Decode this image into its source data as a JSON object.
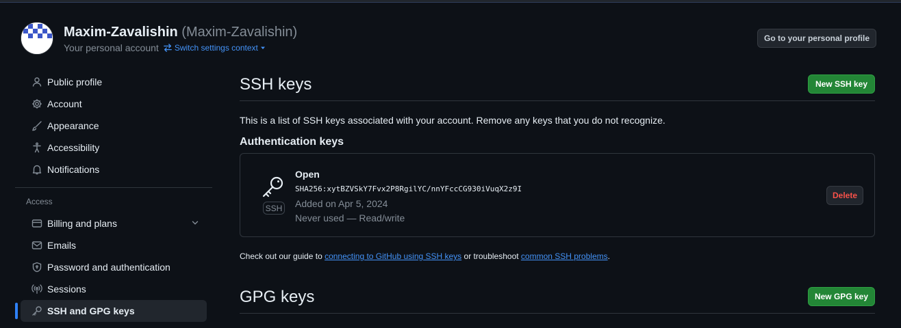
{
  "header": {
    "name": "Maxim-Zavalishin",
    "handle": "(Maxim-Zavalishin)",
    "subtitle": "Your personal account",
    "switch_label": "Switch settings context",
    "profile_button": "Go to your personal profile"
  },
  "sidebar": {
    "items": [
      {
        "label": "Public profile",
        "icon": "person-icon"
      },
      {
        "label": "Account",
        "icon": "gear-icon"
      },
      {
        "label": "Appearance",
        "icon": "paintbrush-icon"
      },
      {
        "label": "Accessibility",
        "icon": "accessibility-icon"
      },
      {
        "label": "Notifications",
        "icon": "bell-icon"
      }
    ],
    "group_label": "Access",
    "access_items": [
      {
        "label": "Billing and plans",
        "icon": "credit-card-icon"
      },
      {
        "label": "Emails",
        "icon": "mail-icon"
      },
      {
        "label": "Password and authentication",
        "icon": "shield-lock-icon"
      },
      {
        "label": "Sessions",
        "icon": "broadcast-icon"
      },
      {
        "label": "SSH and GPG keys",
        "icon": "key-icon",
        "active": true
      }
    ]
  },
  "ssh": {
    "title": "SSH keys",
    "new_button": "New SSH key",
    "intro": "This is a list of SSH keys associated with your account. Remove any keys that you do not recognize.",
    "subheading": "Authentication keys",
    "key": {
      "badge": "SSH",
      "title": "Open",
      "fingerprint": "SHA256:xytBZVSkY7Fvx2P8RgilYC/nnYFccCG930iVuqX2z9I",
      "added": "Added on Apr 5, 2024",
      "usage": "Never used — Read/write",
      "delete_button": "Delete"
    },
    "guide_prefix": "Check out our guide to ",
    "guide_link1": "connecting to GitHub using SSH keys",
    "guide_middle": " or troubleshoot ",
    "guide_link2": "common SSH problems",
    "guide_suffix": "."
  },
  "gpg": {
    "title": "GPG keys",
    "new_button": "New GPG key"
  },
  "colors": {
    "background": "#0d1117",
    "accent_link": "#4493f8",
    "primary_button": "#238636",
    "danger": "#f85149",
    "active_indicator": "#2f81f7"
  }
}
